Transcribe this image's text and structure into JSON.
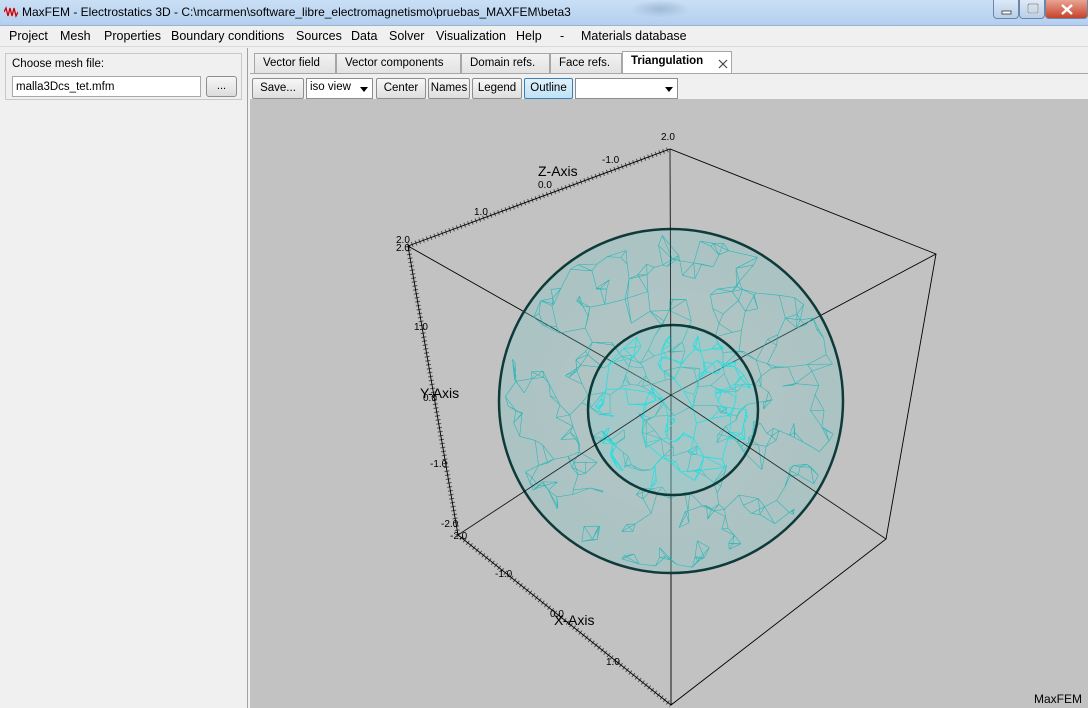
{
  "window": {
    "title": "MaxFEM - Electrostatics 3D - C:\\mcarmen\\software_libre_electromagnetismo\\pruebas_MAXFEM\\beta3",
    "icons": {
      "app": "wave-icon",
      "minimize": "minimize-icon",
      "maximize": "maximize-icon",
      "close": "close-icon"
    },
    "accent": "#b4cfee"
  },
  "menu": {
    "items": [
      {
        "label": "Project"
      },
      {
        "label": "Mesh"
      },
      {
        "label": "Properties"
      },
      {
        "label": "Boundary conditions"
      },
      {
        "label": "Sources"
      },
      {
        "label": "Data"
      },
      {
        "label": "Solver"
      },
      {
        "label": "Visualization"
      },
      {
        "label": "Help"
      },
      {
        "label": "-"
      },
      {
        "label": "Materials database"
      }
    ]
  },
  "left_panel": {
    "label": "Choose mesh file:",
    "mesh_file_value": "malla3Dcs_tet.mfm",
    "browse_label": "..."
  },
  "tabs": {
    "items": [
      {
        "label": "Vector field"
      },
      {
        "label": "Vector components"
      },
      {
        "label": "Domain refs."
      },
      {
        "label": "Face refs."
      },
      {
        "label": "Triangulation"
      }
    ],
    "active": "Triangulation",
    "close_icon": "close-icon"
  },
  "toolbar": {
    "save_label": "Save...",
    "view_select_value": "iso view",
    "center_label": "Center",
    "names_label": "Names",
    "legend_label": "Legend",
    "outline_label": "Outline",
    "outline_pressed": true,
    "empty_select_value": ""
  },
  "viewport": {
    "background": "#c2c2c2",
    "mesh_color": "#2fd6d6",
    "mesh_edge_color": "#0e3a3a",
    "axes": {
      "z_label": "Z-Axis",
      "y_label": "Y-Axis",
      "x_label": "X-Axis",
      "z_ticks": [
        "2.0",
        "-1.0",
        "0.0",
        "1.0",
        "2.0"
      ],
      "y_ticks": [
        "2.0",
        "1.0",
        "0.0",
        "-1.0",
        "-2.0"
      ],
      "x_ticks": [
        "-2.0",
        "-1.0",
        "0.0",
        "1.0"
      ]
    },
    "watermark": "MaxFEM"
  }
}
